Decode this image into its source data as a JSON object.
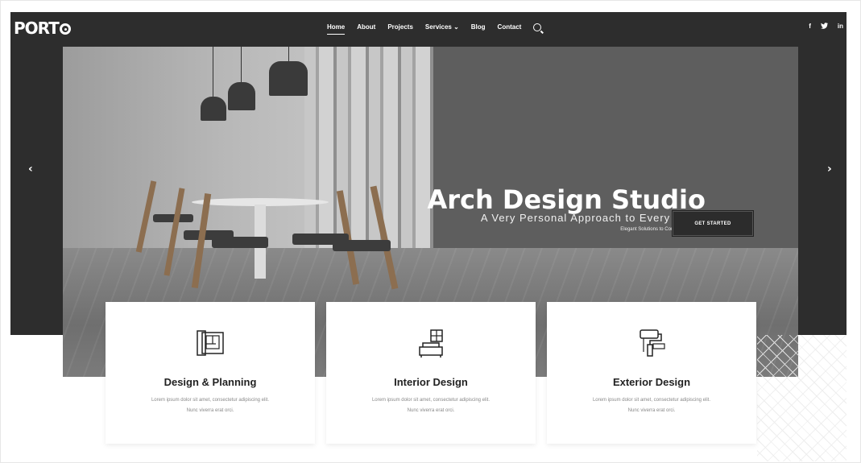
{
  "header": {
    "logo": "PORTO",
    "nav": [
      {
        "label": "Home",
        "active": true
      },
      {
        "label": "About"
      },
      {
        "label": "Projects"
      },
      {
        "label": "Services ⌄"
      },
      {
        "label": "Blog"
      },
      {
        "label": "Contact"
      }
    ],
    "social": [
      "f",
      "t",
      "in"
    ]
  },
  "hero": {
    "title": "Arch Design Studio",
    "subtitle": "A Very Personal Approach to Every Client",
    "tagline": "Elegant Solutions to Complex Problems",
    "cta": "GET STARTED",
    "prev_arrow": "‹",
    "next_arrow": "›"
  },
  "cards": [
    {
      "title": "Design & Planning",
      "desc1": "Lorem ipsum dolor sit amet, consectetur adipiscing elit.",
      "desc2": "Nunc viverra erat orci.",
      "icon": "blueprint-icon"
    },
    {
      "title": "Interior Design",
      "desc1": "Lorem ipsum dolor sit amet, consectetur adipiscing elit.",
      "desc2": "Nunc viverra erat orci.",
      "icon": "sofa-icon"
    },
    {
      "title": "Exterior Design",
      "desc1": "Lorem ipsum dolor sit amet, consectetur adipiscing elit.",
      "desc2": "Nunc viverra erat orci.",
      "icon": "paint-roller-icon"
    }
  ],
  "colors": {
    "dark": "#2d2d2d",
    "hero": "#6a6a6a",
    "text": "#222222",
    "muted": "#888888"
  }
}
